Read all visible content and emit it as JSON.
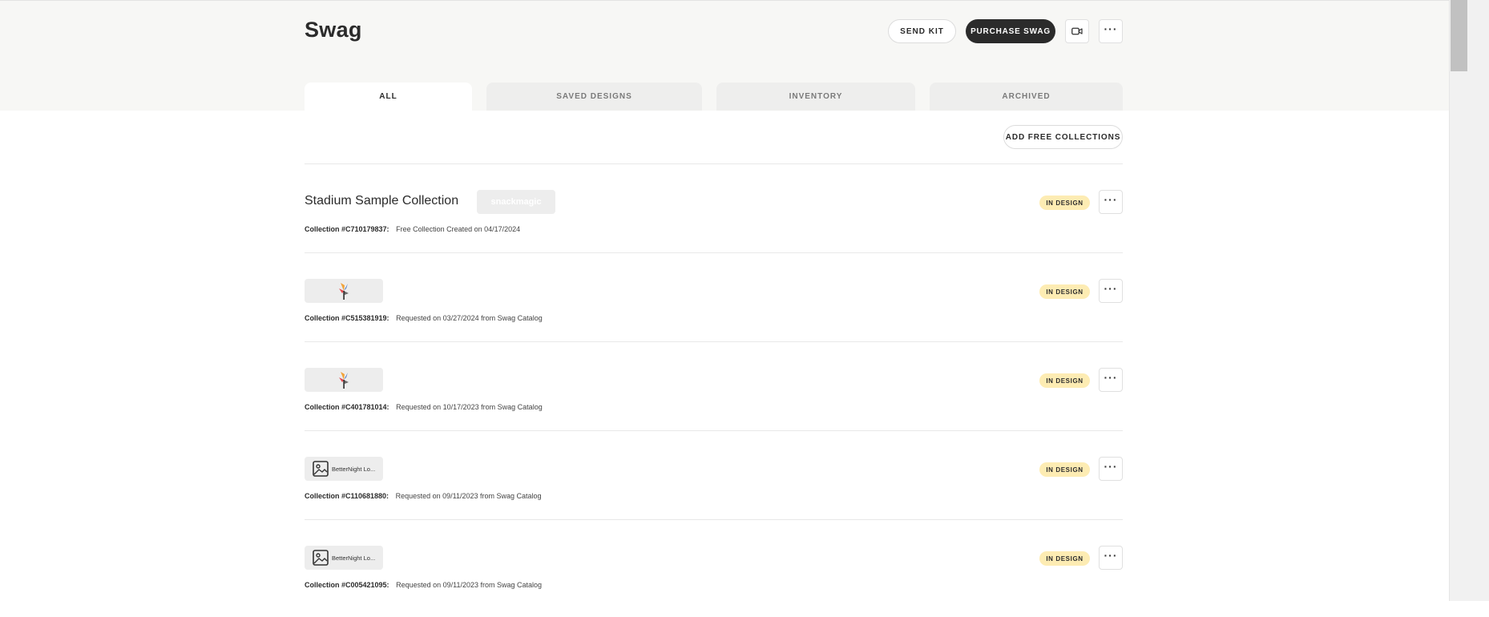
{
  "header": {
    "title": "Swag",
    "send_kit_label": "SEND KIT",
    "purchase_swag_label": "PURCHASE SWAG",
    "video_icon": "video-camera-icon",
    "more_icon": "ellipsis-icon",
    "more_label": "···"
  },
  "tabs": [
    {
      "label": "ALL",
      "active": true
    },
    {
      "label": "SAVED DESIGNS",
      "active": false
    },
    {
      "label": "INVENTORY",
      "active": false
    },
    {
      "label": "ARCHIVED",
      "active": false
    }
  ],
  "actions": {
    "add_free_collections_label": "ADD FREE COLLECTIONS"
  },
  "collections": [
    {
      "title": "Stadium Sample Collection",
      "brand_chip": "snackmagic",
      "collection_id": "Collection #C710179837:",
      "detail": "Free Collection Created on 04/17/2024",
      "status": "IN DESIGN",
      "more_label": "···"
    },
    {
      "logo": "pinwheel-logo",
      "collection_id": "Collection #C515381919:",
      "detail": "Requested on 03/27/2024 from Swag Catalog",
      "status": "IN DESIGN",
      "more_label": "···"
    },
    {
      "logo": "pinwheel-logo",
      "collection_id": "Collection #C401781014:",
      "detail": "Requested on 10/17/2023 from Swag Catalog",
      "status": "IN DESIGN",
      "more_label": "···"
    },
    {
      "image_label": "BetterNight Lo...",
      "collection_id": "Collection #C110681880:",
      "detail": "Requested on 09/11/2023 from Swag Catalog",
      "status": "IN DESIGN",
      "more_label": "···"
    },
    {
      "image_label": "BetterNight Lo...",
      "collection_id": "Collection #C005421095:",
      "detail": "Requested on 09/11/2023 from Swag Catalog",
      "status": "IN DESIGN",
      "more_label": "···"
    }
  ],
  "colors": {
    "header_bg": "#f7f7f5",
    "dark_button": "#2b2b2b",
    "status_badge": "#fdecb3",
    "tab_inactive": "#eeeeed"
  }
}
